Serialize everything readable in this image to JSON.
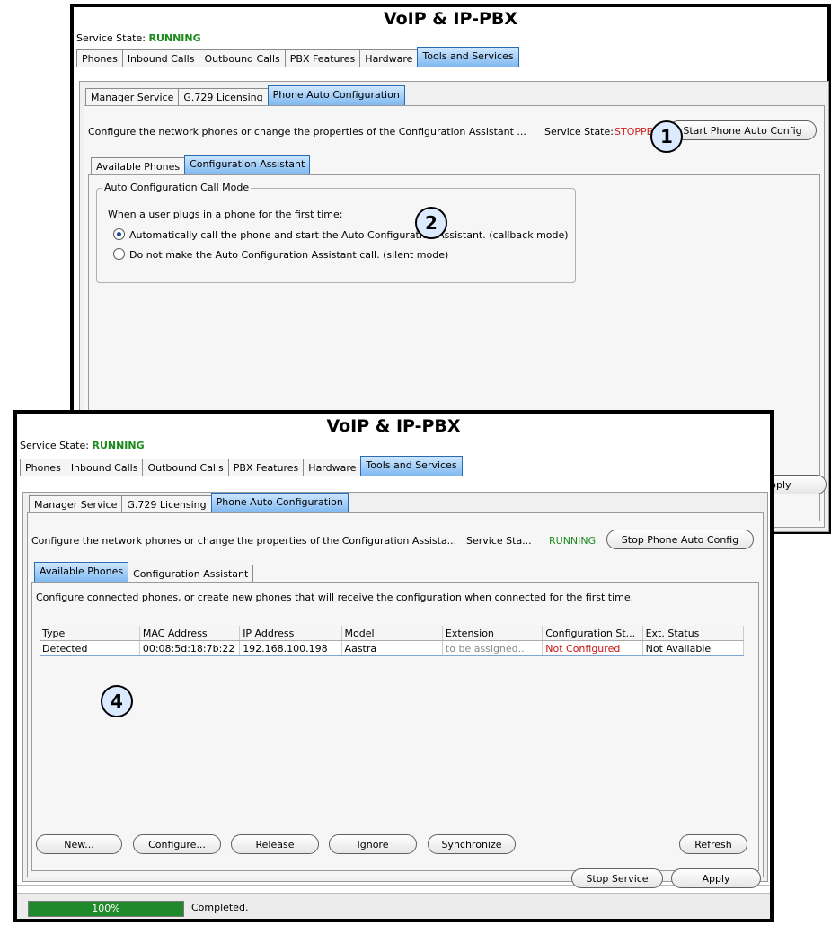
{
  "top": {
    "title": "VoIP & IP-PBX",
    "service_state_label": "Service State:",
    "service_state_value": "RUNNING",
    "tabs": [
      "Phones",
      "Inbound Calls",
      "Outbound Calls",
      "PBX Features",
      "Hardware",
      "Tools and Services"
    ],
    "subtabs": [
      "Manager Service",
      "G.729 Licensing",
      "Phone Auto Configuration"
    ],
    "desc": "Configure the network phones or change the properties of the Configuration Assistant ...",
    "svc_label": "Service State:",
    "svc_value": "STOPPED",
    "start_button": "Start Phone Auto Config",
    "inner_tabs": [
      "Available Phones",
      "Configuration Assistant"
    ],
    "group_title": "Auto Configuration Call Mode",
    "prompt": "When a user plugs in a phone for the first time:",
    "option1": "Automatically call the phone and start the Auto Configuration Assistant. (callback mode)",
    "option2": "Do not make the Auto Configuration Assistant call. (silent mode)",
    "apply_partial": "pply"
  },
  "bottom": {
    "title": "VoIP & IP-PBX",
    "service_state_label": "Service State:",
    "service_state_value": "RUNNING",
    "tabs": [
      "Phones",
      "Inbound Calls",
      "Outbound Calls",
      "PBX Features",
      "Hardware",
      "Tools and Services"
    ],
    "subtabs": [
      "Manager Service",
      "G.729 Licensing",
      "Phone Auto Configuration"
    ],
    "desc": "Configure the network phones or change the properties of the Configuration Assista...",
    "svc_label": "Service Sta...",
    "svc_value": "RUNNING",
    "stop_button": "Stop Phone Auto Config",
    "inner_tabs": [
      "Available Phones",
      "Configuration Assistant"
    ],
    "phones_desc": "Configure connected phones, or create new phones that will receive the configuration when connected for the first time.",
    "table": {
      "headers": [
        "Type",
        "MAC Address",
        "IP Address",
        "Model",
        "Extension",
        "Configuration St...",
        "Ext. Status"
      ],
      "rows": [
        [
          "Detected",
          "00:08:5d:18:7b:22",
          "192.168.100.198",
          "Aastra",
          "to be assigned..",
          "Not Configured",
          "Not Available"
        ]
      ]
    },
    "buttons": [
      "New...",
      "Configure...",
      "Release",
      "Ignore",
      "Synchronize",
      "Refresh"
    ],
    "stop_service": "Stop Service",
    "apply": "Apply",
    "progress_text": "100%",
    "progress_value": 1.0,
    "status_text": "Completed."
  },
  "badges": [
    "1",
    "2",
    "4"
  ],
  "colors": {
    "selected_tab": "#7bb6ef",
    "running": "#1a8a1a",
    "stopped": "#cc2222",
    "progress": "#1f8a2a"
  }
}
